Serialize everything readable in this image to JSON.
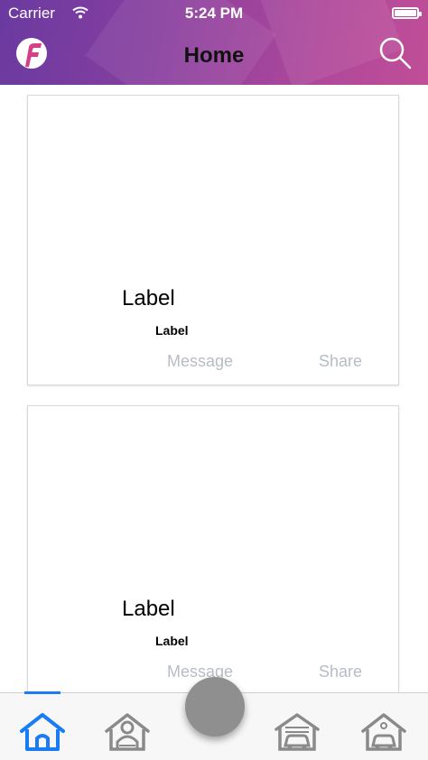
{
  "status_bar": {
    "carrier": "Carrier",
    "time": "5:24 PM"
  },
  "nav": {
    "title": "Home",
    "logo": "app-logo",
    "search_icon": "search-icon"
  },
  "cards": [
    {
      "title": "Label",
      "subtitle": "Label",
      "message": "Message",
      "share": "Share"
    },
    {
      "title": "Label",
      "subtitle": "Label",
      "message": "Message",
      "share": "Share"
    }
  ],
  "tabs": [
    {
      "icon": "home-icon",
      "active": true
    },
    {
      "icon": "profile-house-icon",
      "active": false
    },
    {
      "icon": "center-action-button",
      "active": false
    },
    {
      "icon": "garage-car-icon",
      "active": false
    },
    {
      "icon": "house-car-icon",
      "active": false
    }
  ],
  "colors": {
    "active_tab": "#1a7cf5",
    "inactive_tab": "#8a8a8a",
    "muted_text": "#b7bcc6"
  }
}
